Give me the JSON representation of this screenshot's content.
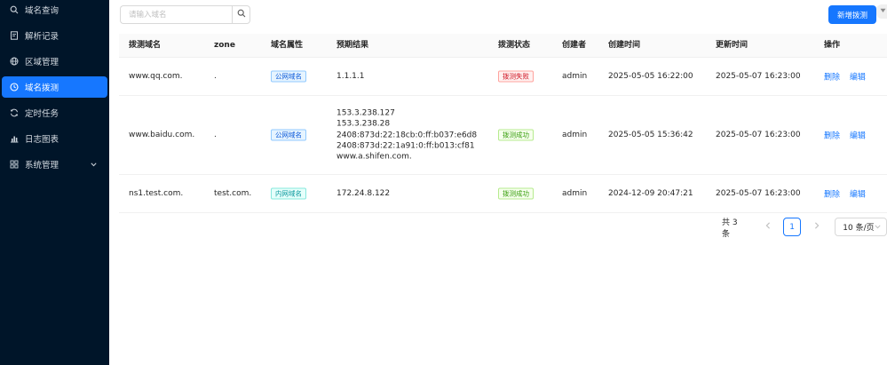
{
  "sidebar": {
    "items": [
      {
        "label": "域名查询",
        "icon": "search-icon"
      },
      {
        "label": "解析记录",
        "icon": "file-icon"
      },
      {
        "label": "区域管理",
        "icon": "globe-icon"
      },
      {
        "label": "域名拨测",
        "icon": "clock-icon",
        "active": true
      },
      {
        "label": "定时任务",
        "icon": "sync-icon"
      },
      {
        "label": "日志图表",
        "icon": "chart-icon"
      },
      {
        "label": "系统管理",
        "icon": "grid-icon"
      }
    ]
  },
  "toolbar": {
    "search_placeholder": "请输入域名",
    "search_value": "",
    "add_label": "新增拨测"
  },
  "table": {
    "columns": [
      "拨测域名",
      "zone",
      "域名属性",
      "预期结果",
      "拨测状态",
      "创建者",
      "创建时间",
      "更新时间",
      "操作"
    ],
    "rows": [
      {
        "domain": "www.qq.com.",
        "zone": ".",
        "attr": "公网域名",
        "attr_type": "public",
        "results": [
          "1.1.1.1"
        ],
        "status": "拨测失败",
        "status_type": "fail",
        "creator": "admin",
        "created": "2025-05-05 16:22:00",
        "updated": "2025-05-07 16:23:00",
        "delete_label": "删除",
        "edit_label": "编辑"
      },
      {
        "domain": "www.baidu.com.",
        "zone": ".",
        "attr": "公网域名",
        "attr_type": "public",
        "results": [
          "153.3.238.127",
          "153.3.238.28",
          "2408:873d:22:18cb:0:ff:b037:e6d8",
          "2408:873d:22:1a91:0:ff:b013:cf81",
          "www.a.shifen.com."
        ],
        "status": "拨测成功",
        "status_type": "success",
        "creator": "admin",
        "created": "2025-05-05 15:36:42",
        "updated": "2025-05-07 16:23:00",
        "delete_label": "删除",
        "edit_label": "编辑"
      },
      {
        "domain": "ns1.test.com.",
        "zone": "test.com.",
        "attr": "内网域名",
        "attr_type": "private",
        "results": [
          "172.24.8.122"
        ],
        "status": "拨测成功",
        "status_type": "success",
        "creator": "admin",
        "created": "2024-12-09 20:47:21",
        "updated": "2025-05-07 16:23:00",
        "delete_label": "删除",
        "edit_label": "编辑"
      }
    ]
  },
  "pagination": {
    "total_text": "共 3 条",
    "current_page": "1",
    "page_size": "10 条/页"
  },
  "colors": {
    "sidebar_bg": "#001529",
    "primary": "#1677ff"
  }
}
